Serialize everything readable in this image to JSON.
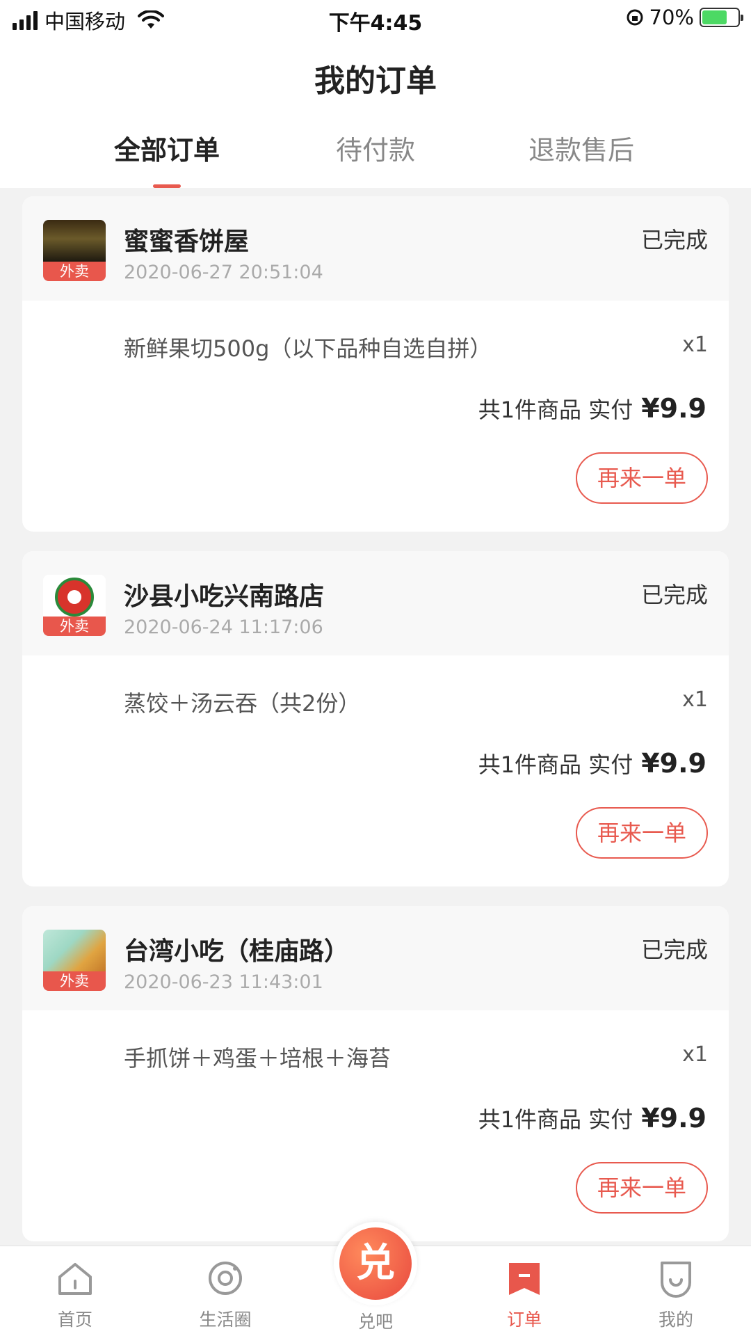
{
  "status_bar": {
    "carrier": "中国移动",
    "time": "下午4:45",
    "battery": "70%",
    "battery_level": 0.7
  },
  "header": {
    "title": "我的订单",
    "tabs": [
      {
        "label": "全部订单",
        "active": true
      },
      {
        "label": "待付款",
        "active": false
      },
      {
        "label": "退款售后",
        "active": false
      }
    ]
  },
  "orders": [
    {
      "shop": "蜜蜜香饼屋",
      "time": "2020-06-27 20:51:04",
      "status": "已完成",
      "tag": "外卖",
      "item": "新鲜果切500g（以下品种自选自拼）",
      "qty": "x1",
      "summary": "共1件商品 实付",
      "price": "¥9.9",
      "button": "再来一单"
    },
    {
      "shop": "沙县小吃兴南路店",
      "time": "2020-06-24 11:17:06",
      "status": "已完成",
      "tag": "外卖",
      "item": "蒸饺＋汤云吞（共2份）",
      "qty": "x1",
      "summary": "共1件商品 实付",
      "price": "¥9.9",
      "button": "再来一单"
    },
    {
      "shop": "台湾小吃（桂庙路）",
      "time": "2020-06-23 11:43:01",
      "status": "已完成",
      "tag": "外卖",
      "item": "手抓饼＋鸡蛋＋培根＋海苔",
      "qty": "x1",
      "summary": "共1件商品 实付",
      "price": "¥9.9",
      "button": "再来一单"
    }
  ],
  "bottom_nav": {
    "items": [
      {
        "label": "首页",
        "icon": "home-icon"
      },
      {
        "label": "生活圈",
        "icon": "life-circle-icon"
      },
      {
        "label": "兑吧",
        "icon": "duiba-icon",
        "glyph": "兑"
      },
      {
        "label": "订单",
        "icon": "orders-icon",
        "active": true
      },
      {
        "label": "我的",
        "icon": "profile-icon"
      }
    ]
  },
  "colors": {
    "accent": "#e85a4f",
    "tag_bg": "#e8574c"
  }
}
